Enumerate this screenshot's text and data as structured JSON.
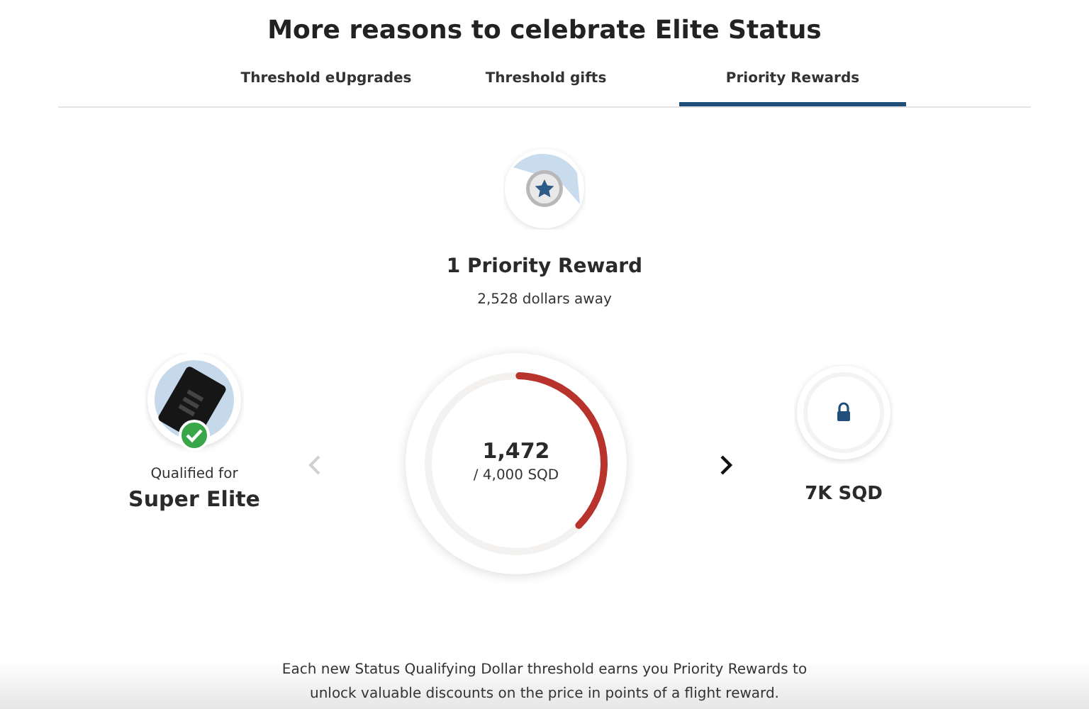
{
  "title": "More reasons to celebrate Elite Status",
  "tabs": [
    {
      "label": "Threshold eUpgrades",
      "selected": false
    },
    {
      "label": "Threshold gifts",
      "selected": false
    },
    {
      "label": "Priority Rewards",
      "selected": true
    }
  ],
  "reward": {
    "count_label": "1 Priority Reward",
    "distance": "2,528 dollars away"
  },
  "nav": {
    "previous_disabled": true,
    "next_disabled": false
  },
  "current_tier": {
    "caption": "Qualified for",
    "name": "Super Elite",
    "qualified": true
  },
  "progress": {
    "value": "1,472",
    "target": "/ 4,000 SQD",
    "level": 0.368
  },
  "next_tier": {
    "label": "7K SQD",
    "locked": true
  },
  "description": "Each new Status Qualifying Dollar threshold earns you Priority Rewards to unlock valuable discounts on the price in points of a flight reward."
}
